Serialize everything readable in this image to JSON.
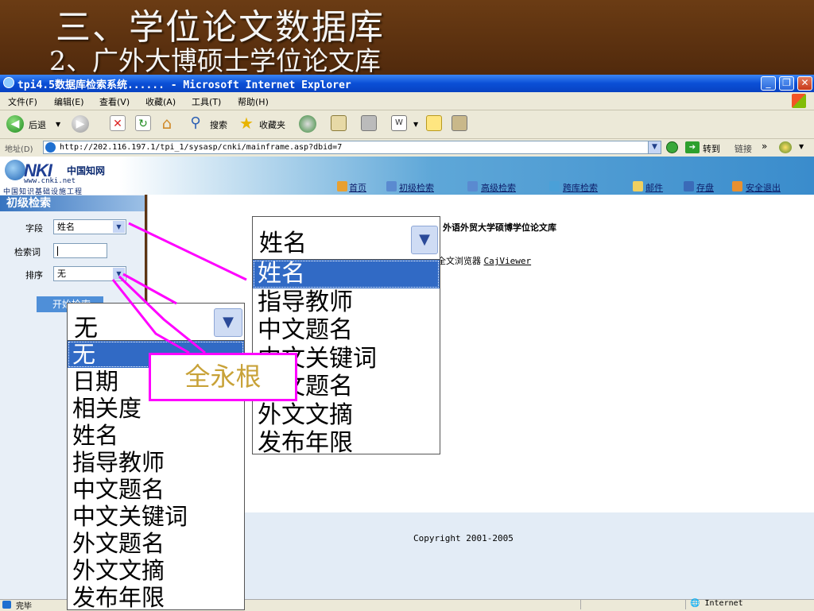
{
  "slide": {
    "title": "三、学位论文数据库",
    "subtitle": "2、广外大博硕士学位论文库"
  },
  "window": {
    "title": "tpi4.5数据库检索系统...... - Microsoft Internet Explorer",
    "minimize": "_",
    "maximize": "❐",
    "close": "✕"
  },
  "menu": [
    "文件(F)",
    "编辑(E)",
    "查看(V)",
    "收藏(A)",
    "工具(T)",
    "帮助(H)"
  ],
  "toolbar": {
    "back": "后退",
    "search": "搜索",
    "favorites": "收藏夹"
  },
  "address": {
    "label": "地址(D)",
    "url": "http://202.116.197.1/tpi_1/sysasp/cnki/mainframe.asp?dbid=7",
    "go": "转到",
    "links": "链接"
  },
  "cnki": {
    "logo_text": "NKI",
    "logo_cn": "中国知网",
    "logo_www": "www.cnki.net",
    "logo_sub": "中国知识基础设施工程",
    "nav": [
      "首页",
      "初级检索",
      "高级检索",
      "跨库检索",
      "邮件",
      "存盘",
      "安全退出"
    ]
  },
  "search_panel": {
    "title": "初级检索",
    "field_label": "字段",
    "field_value": "姓名",
    "keyword_label": "检索词",
    "sort_label": "排序",
    "sort_value": "无",
    "button": "开始检索"
  },
  "content": {
    "title": "外语外贸大学硕博学位论文库",
    "browser_text": "全文浏览器",
    "browser_link": "CajViewer",
    "copyright": "Copyright 2001-2005"
  },
  "status": {
    "left": "完毕",
    "zone": "Internet"
  },
  "field_dropdown": {
    "selected": "姓名",
    "options": [
      "姓名",
      "指导教师",
      "中文题名",
      "中文关键词",
      "外文题名",
      "外文文摘",
      "发布年限"
    ]
  },
  "sort_dropdown": {
    "selected": "无",
    "options": [
      "无",
      "日期",
      "相关度",
      "姓名",
      "指导教师",
      "中文题名",
      "中文关键词",
      "外文题名",
      "外文文摘",
      "发布年限"
    ]
  },
  "callout": {
    "text": "全永根",
    "color": "#ff00ff"
  }
}
